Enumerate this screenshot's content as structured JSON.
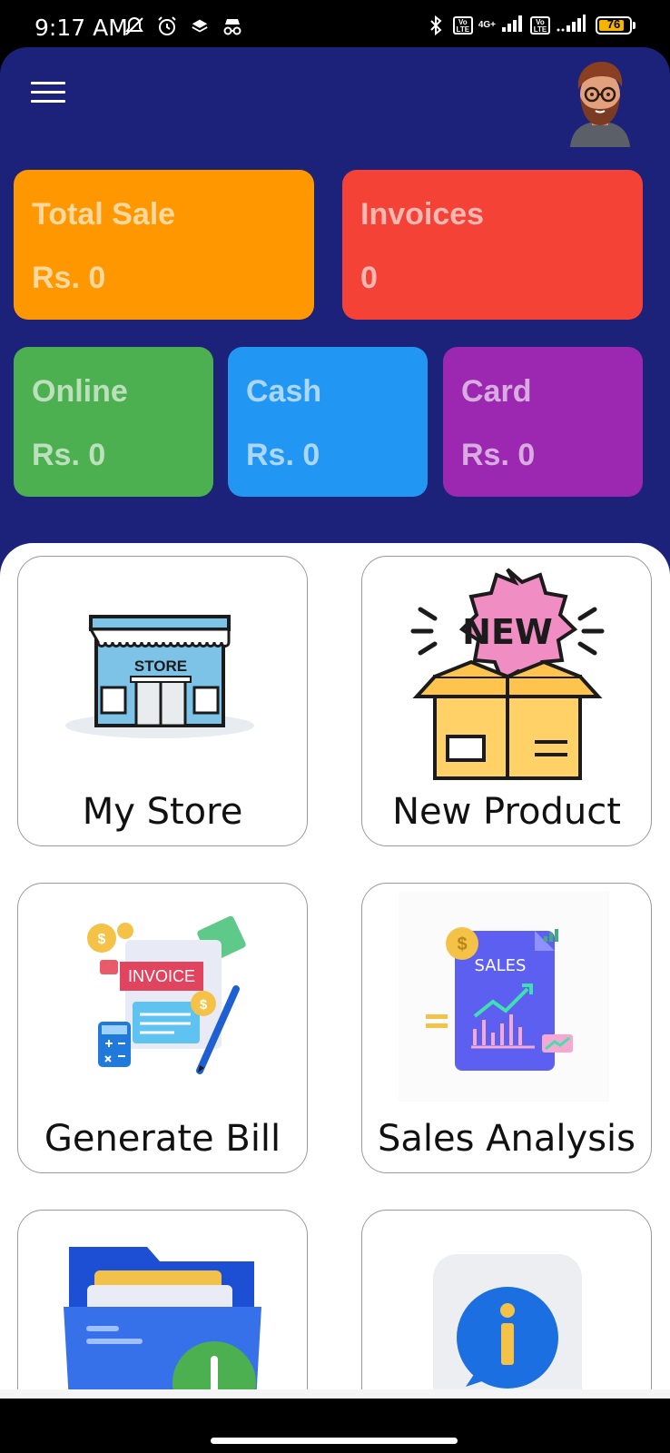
{
  "status_bar": {
    "time": "9:17 AM",
    "net_label_1": "4G+",
    "battery": "76",
    "icons": [
      "bell-off-icon",
      "alarm-icon",
      "layers-icon",
      "incognito-icon",
      "bluetooth-icon",
      "volte-icon",
      "signal-icon",
      "volte-icon",
      "signal-icon",
      "battery-icon"
    ]
  },
  "header": {
    "menu_icon": "menu-icon",
    "avatar": "user-avatar"
  },
  "summary": {
    "total_sale": {
      "label": "Total Sale",
      "value": "Rs. 0",
      "color": "#FF9800"
    },
    "invoices": {
      "label": "Invoices",
      "value": "0",
      "color": "#F44336"
    },
    "online": {
      "label": "Online",
      "value": "Rs. 0",
      "color": "#4CAF50"
    },
    "cash": {
      "label": "Cash",
      "value": "Rs. 0",
      "color": "#2196F3"
    },
    "card": {
      "label": "Card",
      "value": "Rs. 0",
      "color": "#9C27B0"
    }
  },
  "tiles": {
    "my_store": {
      "label": "My Store",
      "icon": "store-icon"
    },
    "new_product": {
      "label": "New Product",
      "icon": "new-product-box-icon"
    },
    "generate_bill": {
      "label": "Generate Bill",
      "icon": "invoice-icon"
    },
    "sales_analysis": {
      "label": "Sales Analysis",
      "icon": "sales-chart-icon"
    },
    "folder": {
      "icon": "folder-icon"
    },
    "info": {
      "icon": "info-icon"
    }
  },
  "colors": {
    "header_bg": "#1C2279"
  }
}
